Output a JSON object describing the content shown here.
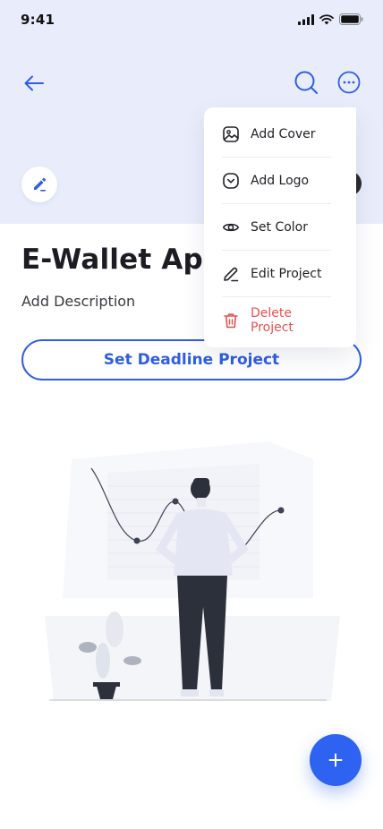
{
  "status_bar": {
    "time": "9:41"
  },
  "project": {
    "title": "E-Wallet App",
    "description": "Add Description"
  },
  "buttons": {
    "deadline_label": "Set Deadline Project",
    "fab_symbol": "+"
  },
  "menu": {
    "items": [
      {
        "label": "Add Cover",
        "icon": "image-icon"
      },
      {
        "label": "Add Logo",
        "icon": "chevron-circle-icon"
      },
      {
        "label": "Set Color",
        "icon": "eye-icon"
      },
      {
        "label": "Edit Project",
        "icon": "pencil-icon"
      },
      {
        "label": "Delete Project",
        "icon": "trash-icon"
      }
    ]
  },
  "colors": {
    "accent": "#2f5ee4",
    "header_bg": "#e9edfb",
    "danger": "#e85050"
  }
}
